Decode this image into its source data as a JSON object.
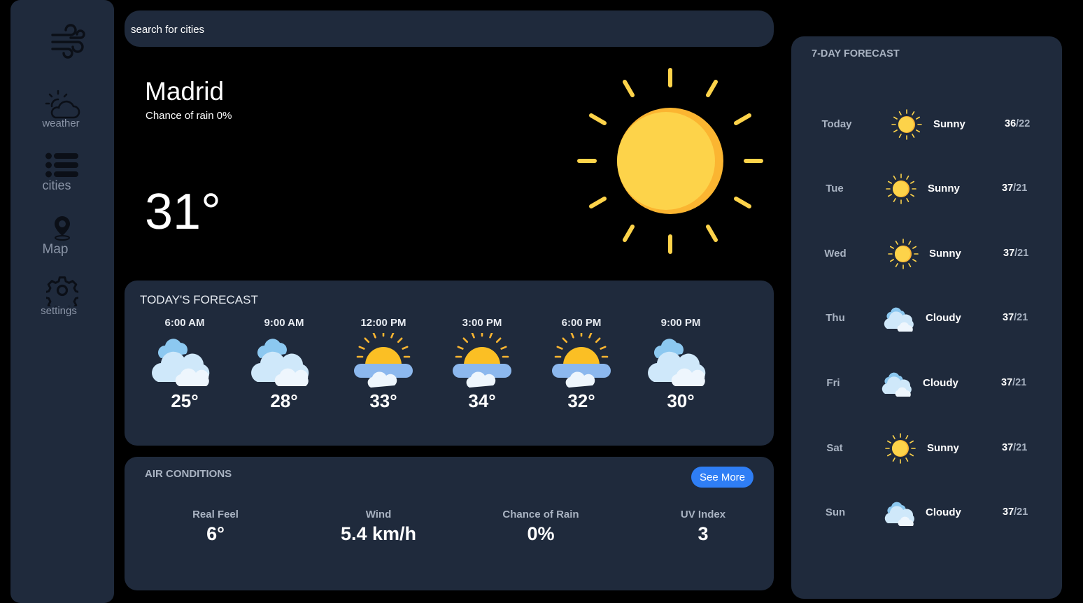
{
  "search": {
    "placeholder": "search for cities"
  },
  "sidebar": {
    "items": [
      {
        "label": "weather"
      },
      {
        "label": "cities"
      },
      {
        "label": "Map"
      },
      {
        "label": "settings"
      }
    ]
  },
  "hero": {
    "city": "Madrid",
    "rain": "Chance of rain 0%",
    "temp": "31°",
    "icon": "sun-icon"
  },
  "today": {
    "title": "TODAY'S FORECAST",
    "hours": [
      {
        "time": "6:00 AM",
        "temp": "25°",
        "icon": "cloudy"
      },
      {
        "time": "9:00 AM",
        "temp": "28°",
        "icon": "cloudy"
      },
      {
        "time": "12:00 PM",
        "temp": "33°",
        "icon": "partly-sunny"
      },
      {
        "time": "3:00 PM",
        "temp": "34°",
        "icon": "partly-sunny"
      },
      {
        "time": "6:00 PM",
        "temp": "32°",
        "icon": "partly-sunny"
      },
      {
        "time": "9:00 PM",
        "temp": "30°",
        "icon": "cloudy"
      }
    ]
  },
  "air": {
    "title": "AIR CONDITIONS",
    "see_more": "See More",
    "metrics": [
      {
        "label": "Real Feel",
        "value": "6°"
      },
      {
        "label": "Wind",
        "value": "5.4 km/h"
      },
      {
        "label": "Chance of Rain",
        "value": "0%"
      },
      {
        "label": "UV Index",
        "value": "3"
      }
    ]
  },
  "week": {
    "title": "7-DAY FORECAST",
    "days": [
      {
        "day": "Today",
        "condition": "Sunny",
        "high": "36",
        "low": "/22",
        "icon": "sunny"
      },
      {
        "day": "Tue",
        "condition": "Sunny",
        "high": "37",
        "low": "/21",
        "icon": "sunny"
      },
      {
        "day": "Wed",
        "condition": "Sunny",
        "high": "37",
        "low": "/21",
        "icon": "sunny"
      },
      {
        "day": "Thu",
        "condition": "Cloudy",
        "high": "37",
        "low": "/21",
        "icon": "cloudy"
      },
      {
        "day": "Fri",
        "condition": "Cloudy",
        "high": "37",
        "low": "/21",
        "icon": "cloudy"
      },
      {
        "day": "Sat",
        "condition": "Sunny",
        "high": "37",
        "low": "/21",
        "icon": "sunny"
      },
      {
        "day": "Sun",
        "condition": "Cloudy",
        "high": "37",
        "low": "/21",
        "icon": "cloudy"
      }
    ]
  },
  "colors": {
    "panel": "#1f2a3c",
    "accent": "#2f7ef5",
    "sun": "#fdd34a",
    "muted": "#a9b3c2"
  }
}
